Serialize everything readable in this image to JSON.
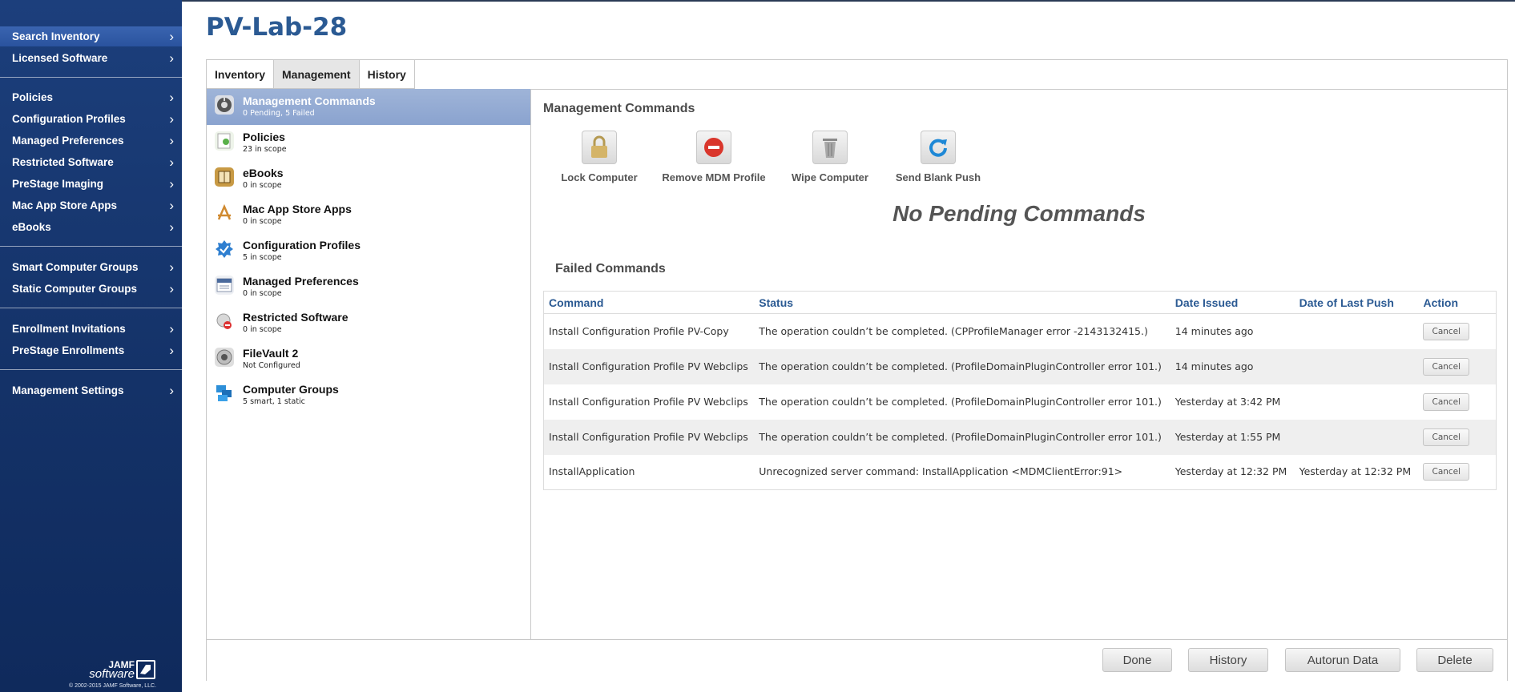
{
  "sidebar": {
    "items": [
      {
        "label": "Search Inventory"
      },
      {
        "label": "Licensed Software"
      },
      {
        "label": "Policies"
      },
      {
        "label": "Configuration Profiles"
      },
      {
        "label": "Managed Preferences"
      },
      {
        "label": "Restricted Software"
      },
      {
        "label": "PreStage Imaging"
      },
      {
        "label": "Mac App Store Apps"
      },
      {
        "label": "eBooks"
      },
      {
        "label": "Smart Computer Groups"
      },
      {
        "label": "Static Computer Groups"
      },
      {
        "label": "Enrollment Invitations"
      },
      {
        "label": "PreStage Enrollments"
      },
      {
        "label": "Management Settings"
      }
    ],
    "chevron": "›",
    "brand_line1": "JAMF",
    "brand_line2": "software",
    "copyright": "© 2002-2015 JAMF Software, LLC."
  },
  "header": {
    "title": "PV-Lab-28"
  },
  "tabs": [
    "Inventory",
    "Management",
    "History"
  ],
  "subnav": [
    {
      "label": "Management Commands",
      "sub": "0 Pending, 5 Failed",
      "icon": "management-commands-icon"
    },
    {
      "label": "Policies",
      "sub": "23 in scope",
      "icon": "policies-icon"
    },
    {
      "label": "eBooks",
      "sub": "0 in scope",
      "icon": "ebooks-icon"
    },
    {
      "label": "Mac App Store Apps",
      "sub": "0 in scope",
      "icon": "app-store-icon"
    },
    {
      "label": "Configuration Profiles",
      "sub": "5 in scope",
      "icon": "configuration-profiles-icon"
    },
    {
      "label": "Managed Preferences",
      "sub": "0 in scope",
      "icon": "managed-preferences-icon"
    },
    {
      "label": "Restricted Software",
      "sub": "0 in scope",
      "icon": "restricted-software-icon"
    },
    {
      "label": "FileVault 2",
      "sub": "Not Configured",
      "icon": "filevault-icon"
    },
    {
      "label": "Computer Groups",
      "sub": "5 smart, 1 static",
      "icon": "computer-groups-icon"
    }
  ],
  "main": {
    "title": "Management Commands",
    "commands": [
      {
        "label": "Lock Computer",
        "icon": "lock-icon"
      },
      {
        "label": "Remove MDM Profile",
        "icon": "remove-icon"
      },
      {
        "label": "Wipe Computer",
        "icon": "trash-icon"
      },
      {
        "label": "Send Blank Push",
        "icon": "refresh-icon"
      }
    ],
    "no_pending": "No Pending Commands",
    "failed_title": "Failed Commands",
    "failed_table": {
      "headers": [
        "Command",
        "Status",
        "Date Issued",
        "Date of Last Push",
        "Action"
      ],
      "rows": [
        {
          "command": "Install Configuration Profile PV-Copy",
          "status": "The operation couldn’t be completed. (CPProfileManager error -2143132415.)",
          "issued": "14 minutes ago",
          "last_push": "",
          "action": "Cancel"
        },
        {
          "command": "Install Configuration Profile PV Webclips",
          "status": "The operation couldn’t be completed. (ProfileDomainPluginController error 101.)",
          "issued": "14 minutes ago",
          "last_push": "",
          "action": "Cancel"
        },
        {
          "command": "Install Configuration Profile PV Webclips",
          "status": "The operation couldn’t be completed. (ProfileDomainPluginController error 101.)",
          "issued": "Yesterday at 3:42 PM",
          "last_push": "",
          "action": "Cancel"
        },
        {
          "command": "Install Configuration Profile PV Webclips",
          "status": "The operation couldn’t be completed. (ProfileDomainPluginController error 101.)",
          "issued": "Yesterday at 1:55 PM",
          "last_push": "",
          "action": "Cancel"
        },
        {
          "command": "InstallApplication",
          "status": "Unrecognized server command: InstallApplication <MDMClientError:91>",
          "issued": "Yesterday at 12:32 PM",
          "last_push": "Yesterday at 12:32 PM",
          "action": "Cancel"
        }
      ]
    }
  },
  "footer": {
    "buttons": [
      "Done",
      "History",
      "Autorun Data",
      "Delete"
    ]
  },
  "colors": {
    "sidebar_bg": "#143268",
    "title_blue": "#2b5a93",
    "active_subnav": "#8aa3cf"
  }
}
